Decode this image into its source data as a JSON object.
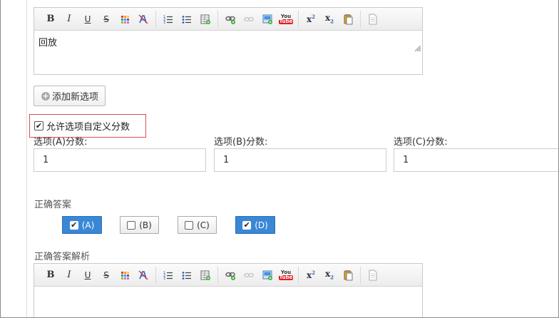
{
  "editor1": {
    "content": "回放",
    "toolbar": [
      "bold-icon",
      "italic-icon",
      "underline-icon",
      "strikethrough-icon",
      "text-color-icon",
      "clear-format-icon",
      "ordered-list-icon",
      "unordered-list-icon",
      "insert-table-icon",
      "insert-link-icon",
      "unlink-icon",
      "insert-image-icon",
      "youtube-icon",
      "superscript-icon",
      "subscript-icon",
      "paste-icon",
      "source-icon"
    ]
  },
  "add_option_label": "添加新选项",
  "custom_score": {
    "label": "允许选项自定义分数",
    "checked": true
  },
  "scores": [
    {
      "label": "选项(A)分数:",
      "value": "1"
    },
    {
      "label": "选项(B)分数:",
      "value": "1"
    },
    {
      "label": "选项(C)分数:",
      "value": "1"
    }
  ],
  "correct_answer": {
    "title": "正确答案",
    "options": [
      {
        "label": "(A)",
        "checked": true
      },
      {
        "label": "(B)",
        "checked": false
      },
      {
        "label": "(C)",
        "checked": false
      },
      {
        "label": "(D)",
        "checked": true
      }
    ]
  },
  "analysis_title": "正确答案解析",
  "editor2": {
    "content": ""
  },
  "toolbar_text": {
    "bold": "B",
    "italic": "I",
    "underline": "U",
    "strike": "S",
    "youtube_top": "You",
    "youtube_bottom": "Tube",
    "sup_base": "x",
    "sup": "2",
    "sub_base": "x",
    "sub": "2"
  },
  "colors": {
    "accent": "#3a87d6",
    "highlight_border": "#d9534f"
  }
}
